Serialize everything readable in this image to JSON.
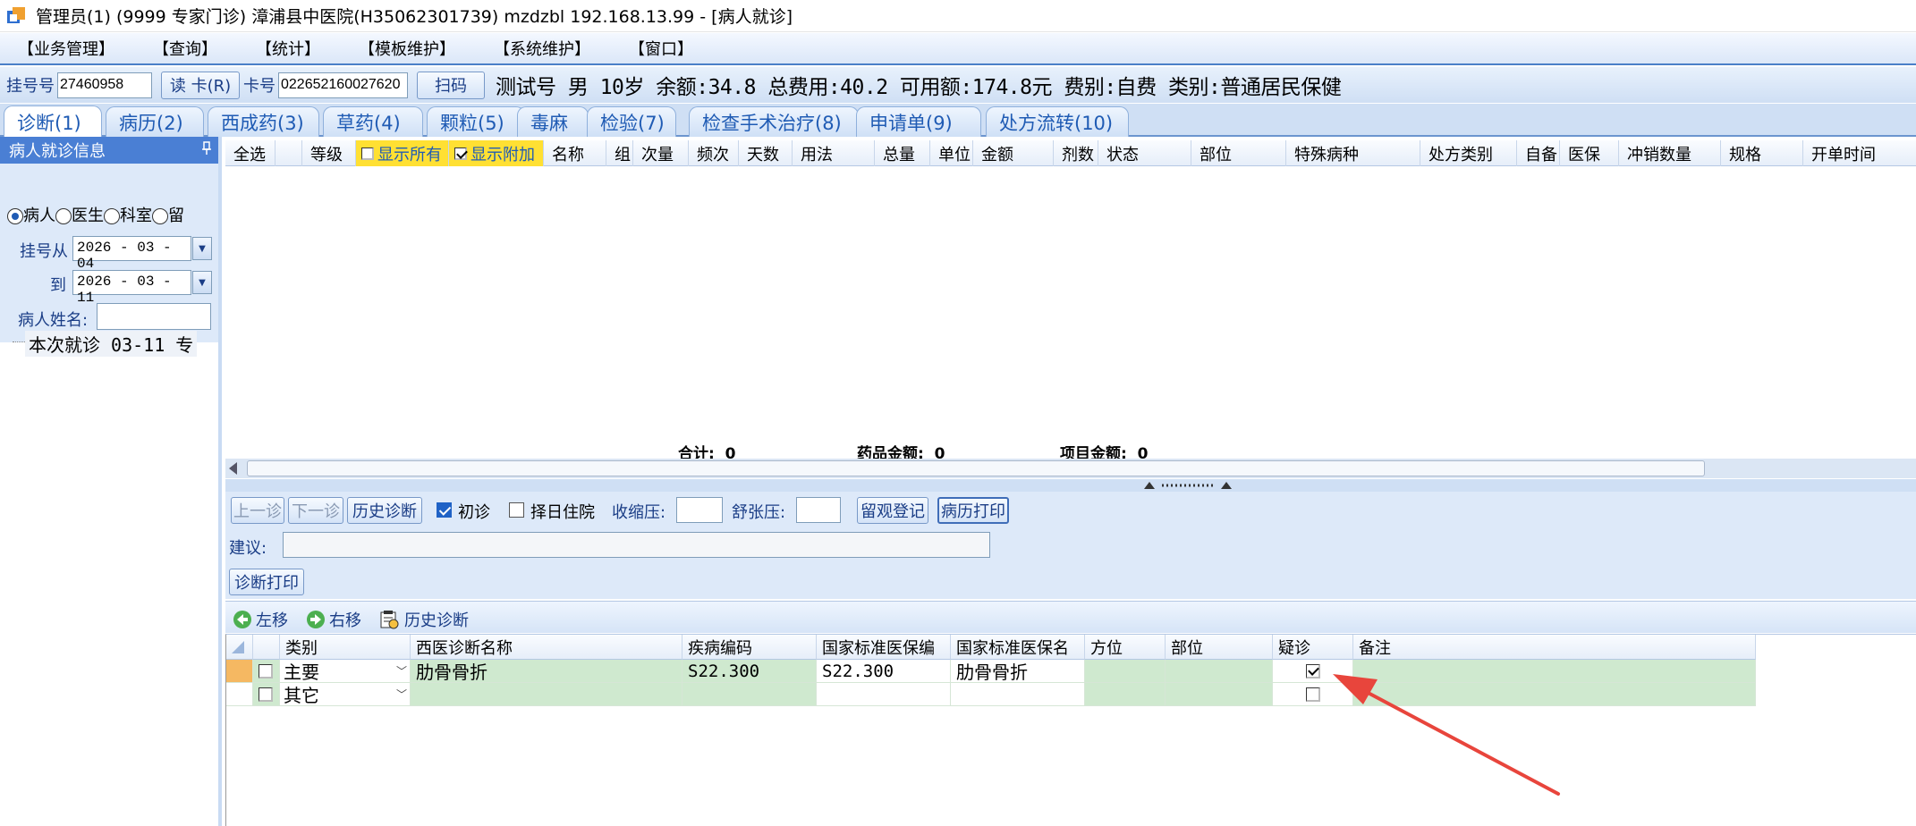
{
  "window": {
    "title": "管理员(1) (9999 专家门诊) 漳浦县中医院(H35062301739) mzdzbl 192.168.13.99 - [病人就诊]"
  },
  "menu": [
    "【业务管理】",
    "【查询】",
    "【统计】",
    "【模板维护】",
    "【系统维护】",
    "【窗口】"
  ],
  "toolbar": {
    "reg_no_label": "挂号号",
    "reg_no_value": "27460958",
    "read_card_label": "读 卡(R)",
    "card_no_label": "卡号",
    "card_no_value": "022652160027620",
    "scan_label": "扫码",
    "patient_info": "测试号 男   10岁  余额:34.8 总费用:40.2 可用额:174.8元  费别:自费 类别:普通居民保健"
  },
  "tabs": [
    "诊断(1)",
    "病历(2)",
    "西成药(3)",
    "草药(4)",
    "颗粒(5)",
    "毒麻",
    "检验(7)",
    "检查手术治疗(8)",
    "申请单(9)",
    "处方流转(10)"
  ],
  "left": {
    "header": "病人就诊信息",
    "pin": "ᵖ",
    "radios": [
      "病人",
      "医生",
      "科室",
      "留"
    ],
    "reg_from_label": "挂号从",
    "reg_from": "2026 - 03 - 04",
    "reg_to_label": "到",
    "reg_to": "2026 - 03 - 11",
    "name_label": "病人姓名:",
    "tree_item": "本次就诊  03-11  专"
  },
  "order_columns": [
    "全选",
    "",
    "等级",
    "显示所有",
    "显示附加",
    "名称",
    "组",
    "次量",
    "频次",
    "天数",
    "用法",
    "总量",
    "单位",
    "金额",
    "剂数",
    "状态",
    "部位",
    "特殊病种",
    "处方类别",
    "自备",
    "医保",
    "冲销数量",
    "规格",
    "开单时间"
  ],
  "totals": {
    "sum_label": "合计:",
    "sum_value": "0",
    "drug_label": "药品金额:",
    "drug_value": "0",
    "item_label": "项目金额:",
    "item_value": "0"
  },
  "diag_panel": {
    "prev": "上一诊",
    "next": "下一诊",
    "history": "历史诊断",
    "first_visit": "初诊",
    "admit": "择日住院",
    "systolic_label": "收缩压:",
    "diastolic_label": "舒张压:",
    "observe": "留观登记",
    "print_record": "病历打印",
    "suggest_label": "建议:",
    "diag_print": "诊断打印"
  },
  "diag_toolbar": {
    "left": "左移",
    "right": "右移",
    "history": "历史诊断"
  },
  "diag_columns": [
    "",
    "",
    "类别",
    "西医诊断名称",
    "疾病编码",
    "国家标准医保编",
    "国家标准医保名",
    "方位",
    "部位",
    "疑诊",
    "备注"
  ],
  "diag_rows": [
    {
      "category": "主要",
      "name": "肋骨骨折",
      "code": "S22.300",
      "ins_code": "S22.300",
      "ins_name": "肋骨骨折",
      "suspect": true
    },
    {
      "category": "其它",
      "name": "",
      "code": "",
      "ins_code": "",
      "ins_name": "",
      "suspect": false
    }
  ],
  "colors": {
    "accent": "#4a7fd4",
    "row_green": "#cfe9cf",
    "arrow": "#e8453c",
    "highlight_yellow": "#ffe033"
  }
}
